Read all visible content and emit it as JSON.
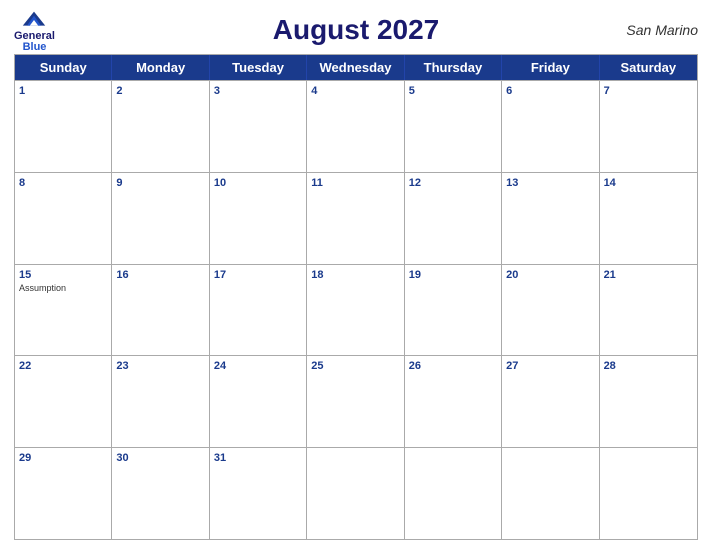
{
  "header": {
    "title": "August 2027",
    "country": "San Marino",
    "logo": {
      "line1": "General",
      "line2": "Blue"
    }
  },
  "days": {
    "headers": [
      "Sunday",
      "Monday",
      "Tuesday",
      "Wednesday",
      "Thursday",
      "Friday",
      "Saturday"
    ]
  },
  "weeks": [
    [
      {
        "date": "1",
        "events": []
      },
      {
        "date": "2",
        "events": []
      },
      {
        "date": "3",
        "events": []
      },
      {
        "date": "4",
        "events": []
      },
      {
        "date": "5",
        "events": []
      },
      {
        "date": "6",
        "events": []
      },
      {
        "date": "7",
        "events": []
      }
    ],
    [
      {
        "date": "8",
        "events": []
      },
      {
        "date": "9",
        "events": []
      },
      {
        "date": "10",
        "events": []
      },
      {
        "date": "11",
        "events": []
      },
      {
        "date": "12",
        "events": []
      },
      {
        "date": "13",
        "events": []
      },
      {
        "date": "14",
        "events": []
      }
    ],
    [
      {
        "date": "15",
        "events": [
          "Assumption"
        ]
      },
      {
        "date": "16",
        "events": []
      },
      {
        "date": "17",
        "events": []
      },
      {
        "date": "18",
        "events": []
      },
      {
        "date": "19",
        "events": []
      },
      {
        "date": "20",
        "events": []
      },
      {
        "date": "21",
        "events": []
      }
    ],
    [
      {
        "date": "22",
        "events": []
      },
      {
        "date": "23",
        "events": []
      },
      {
        "date": "24",
        "events": []
      },
      {
        "date": "25",
        "events": []
      },
      {
        "date": "26",
        "events": []
      },
      {
        "date": "27",
        "events": []
      },
      {
        "date": "28",
        "events": []
      }
    ],
    [
      {
        "date": "29",
        "events": []
      },
      {
        "date": "30",
        "events": []
      },
      {
        "date": "31",
        "events": []
      },
      {
        "date": "",
        "events": []
      },
      {
        "date": "",
        "events": []
      },
      {
        "date": "",
        "events": []
      },
      {
        "date": "",
        "events": []
      }
    ]
  ]
}
